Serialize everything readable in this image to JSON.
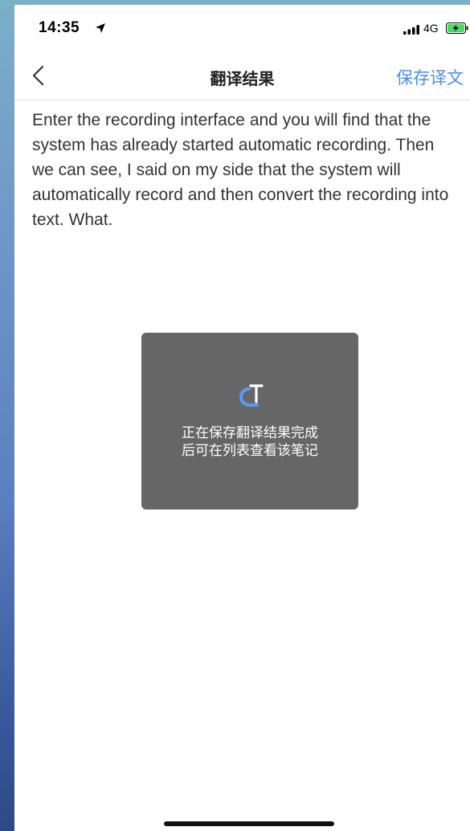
{
  "status_bar": {
    "time": "14:35",
    "network": "4G",
    "icons": [
      "location-arrow-icon",
      "signal-icon",
      "battery-charging-icon"
    ],
    "battery_color": "#4cd964"
  },
  "nav": {
    "back_icon": "chevron-left-icon",
    "title": "翻译结果",
    "save_label": "保存译文",
    "accent_color": "#4a8ef0"
  },
  "content": {
    "text": "Enter the recording interface and you will find that the system has already started automatic recording. Then we can see, I said on my side that the system will automatically record and then convert the recording into text. What."
  },
  "toast": {
    "icon": "loading-logo-icon",
    "line1": "正在保存翻译结果完成",
    "line2": "后可在列表查看该笔记"
  }
}
